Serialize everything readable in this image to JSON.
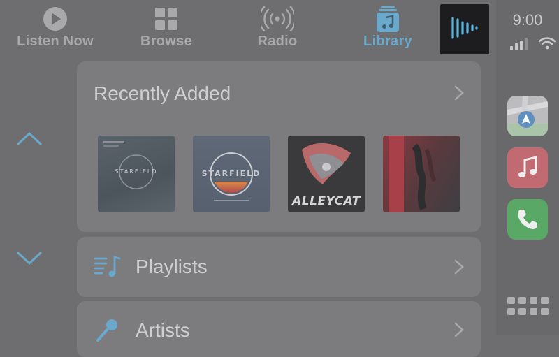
{
  "tabs": [
    {
      "label": "Listen Now",
      "icon": "play-circle-icon",
      "active": false
    },
    {
      "label": "Browse",
      "icon": "grid-squares-icon",
      "active": false
    },
    {
      "label": "Radio",
      "icon": "radio-waves-icon",
      "active": false
    },
    {
      "label": "Library",
      "icon": "music-library-icon",
      "active": true
    }
  ],
  "now_playing": {
    "icon": "now-playing-waveform-icon"
  },
  "status": {
    "time": "9:00"
  },
  "recently_added": {
    "title": "Recently Added",
    "albums": [
      {
        "text": "STARFIELD"
      },
      {
        "text": "STARFIELD"
      },
      {
        "text": "ALLEYCAT"
      },
      {
        "text": ""
      }
    ]
  },
  "rows": {
    "playlists": "Playlists",
    "artists": "Artists"
  },
  "dock": {
    "apps": [
      "maps-app-icon",
      "music-app-icon",
      "phone-app-icon"
    ]
  },
  "colors": {
    "background": "#6e6e70",
    "accent": "#6aa8cc",
    "card": "#7c7c7e"
  }
}
